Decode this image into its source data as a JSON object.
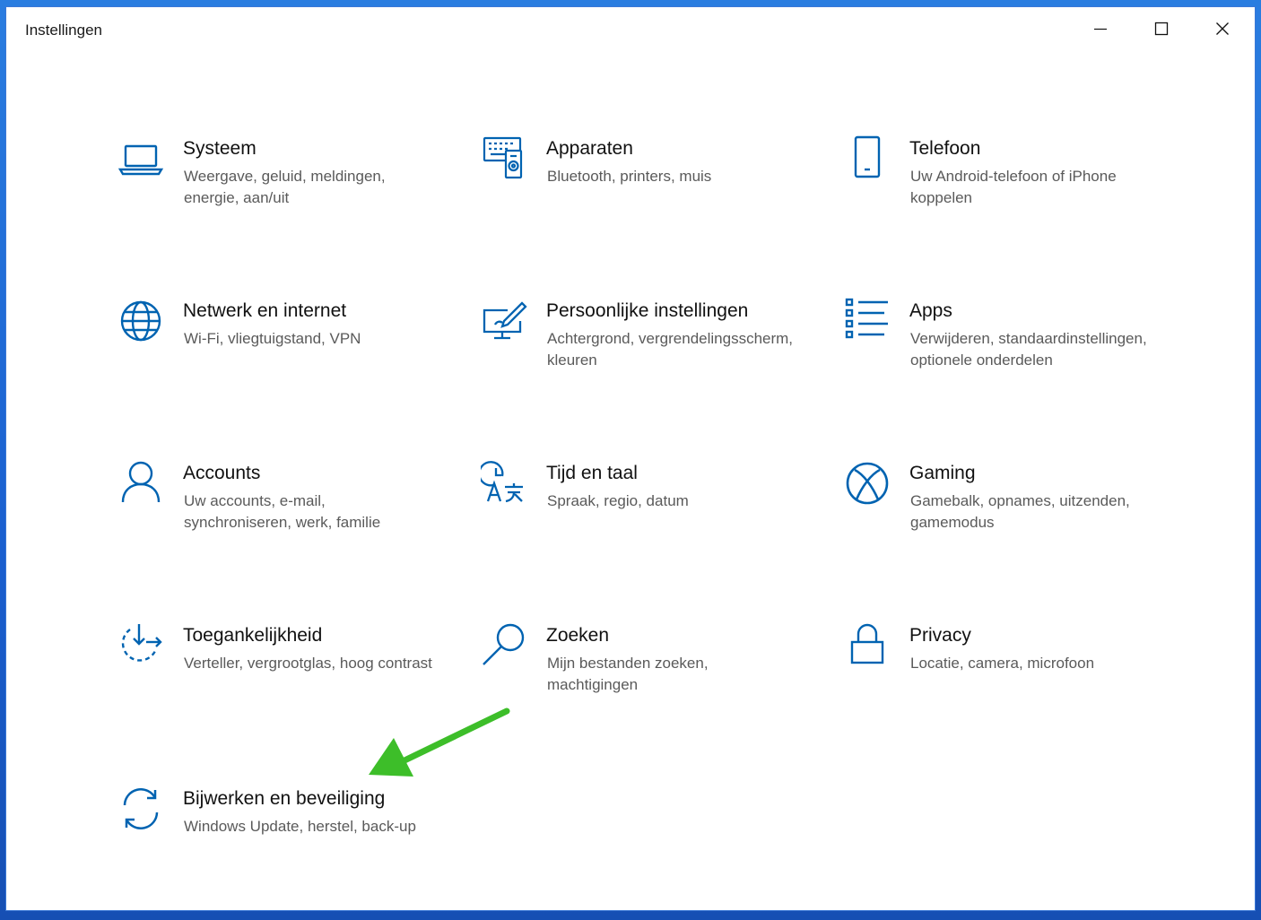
{
  "window": {
    "title": "Instellingen"
  },
  "colors": {
    "accent": "#0063B1",
    "arrow": "#3DBE29"
  },
  "tiles": [
    {
      "name": "Systeem",
      "desc": "Weergave, geluid, meldingen, energie, aan/uit",
      "icon": "laptop-icon"
    },
    {
      "name": "Apparaten",
      "desc": "Bluetooth, printers, muis",
      "icon": "devices-icon"
    },
    {
      "name": "Telefoon",
      "desc": "Uw Android-telefoon of iPhone koppelen",
      "icon": "phone-icon"
    },
    {
      "name": "Netwerk en internet",
      "desc": "Wi-Fi, vliegtuigstand, VPN",
      "icon": "globe-icon"
    },
    {
      "name": "Persoonlijke instellingen",
      "desc": "Achtergrond, vergrendelingsscherm, kleuren",
      "icon": "personalization-icon"
    },
    {
      "name": "Apps",
      "desc": "Verwijderen, standaardinstellingen, optionele onderdelen",
      "icon": "apps-list-icon"
    },
    {
      "name": "Accounts",
      "desc": "Uw accounts, e-mail, synchroniseren, werk, familie",
      "icon": "person-icon"
    },
    {
      "name": "Tijd en taal",
      "desc": "Spraak, regio, datum",
      "icon": "time-language-icon"
    },
    {
      "name": "Gaming",
      "desc": "Gamebalk, opnames, uitzenden, gamemodus",
      "icon": "xbox-icon"
    },
    {
      "name": "Toegankelijkheid",
      "desc": "Verteller, vergrootglas, hoog contrast",
      "icon": "ease-of-access-icon"
    },
    {
      "name": "Zoeken",
      "desc": "Mijn bestanden zoeken, machtigingen",
      "icon": "search-icon"
    },
    {
      "name": "Privacy",
      "desc": "Locatie, camera, microfoon",
      "icon": "lock-icon"
    },
    {
      "name": "Bijwerken en beveiliging",
      "desc": "Windows Update, herstel, back-up",
      "icon": "sync-icon"
    }
  ]
}
